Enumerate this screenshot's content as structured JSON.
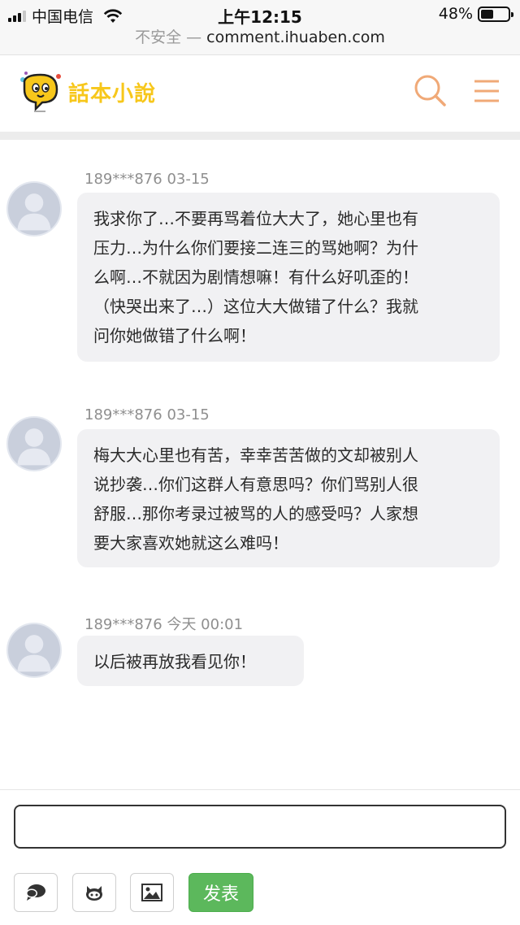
{
  "status_bar": {
    "carrier": "中国电信",
    "time": "上午12:15",
    "battery_percent": "48%",
    "battery_level": 0.48,
    "signal_bars_active": 3,
    "signal_bars_total": 4
  },
  "url_bar": {
    "security_label": "不安全 —",
    "domain": "comment.ihuaben.com"
  },
  "header": {
    "logo_text": "話本小說",
    "logo_icon": "speech-bubble-face-icon",
    "search_icon": "search-icon",
    "menu_icon": "hamburger-menu-icon",
    "accent_color": "#f0a977",
    "logo_color": "#f7c71b"
  },
  "comments": [
    {
      "user": "189***876",
      "date": "03-15",
      "lines": [
        "我求你了…不要再骂着位大大了，她心里也有",
        "压力…为什么你们要接二连三的骂她啊？为什",
        "么啊…不就因为剧情想嘛！有什么好叽歪的！",
        "（快哭出来了…）这位大大做错了什么？我就",
        "问你她做错了什么啊！"
      ]
    },
    {
      "user": "189***876",
      "date": "03-15",
      "lines": [
        "梅大大心里也有苦，幸幸苦苦做的文却被别人",
        "说抄袭…你们这群人有意思吗？你们骂别人很",
        "舒服…那你考录过被骂的人的感受吗？人家想",
        "要大家喜欢她就这么难吗！"
      ]
    },
    {
      "user": "189***876",
      "date": "今天 00:01",
      "lines": [
        "以后被再放我看见你！"
      ]
    }
  ],
  "composer": {
    "input_value": "",
    "submit_label": "发表",
    "submit_color": "#5cb85c",
    "tools": [
      "comment-icon",
      "github-icon",
      "image-icon"
    ]
  }
}
